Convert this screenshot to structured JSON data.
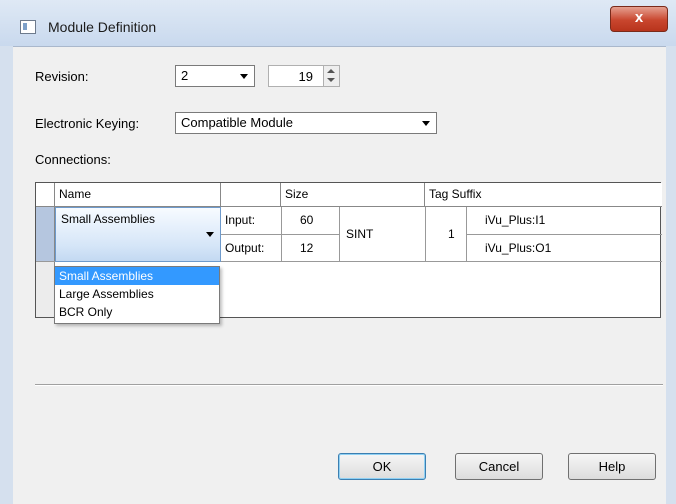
{
  "window": {
    "title": "Module Definition",
    "close_label": "x"
  },
  "revision": {
    "label": "Revision:",
    "major": "2",
    "minor": "19"
  },
  "keying": {
    "label": "Electronic Keying:",
    "value": "Compatible Module"
  },
  "connections": {
    "label": "Connections:",
    "headers": {
      "name": "Name",
      "size": "Size",
      "tag_suffix": "Tag Suffix"
    },
    "selected_name": "Small Assemblies",
    "rows": [
      {
        "io": "Input:",
        "size": "60",
        "tag": "iVu_Plus:I1"
      },
      {
        "io": "Output:",
        "size": "12",
        "tag": "iVu_Plus:O1"
      }
    ],
    "datatype": "SINT",
    "instance": "1"
  },
  "name_options": [
    "Small Assemblies",
    "Large Assemblies",
    "BCR Only"
  ],
  "buttons": {
    "ok": "OK",
    "cancel": "Cancel",
    "help": "Help"
  }
}
